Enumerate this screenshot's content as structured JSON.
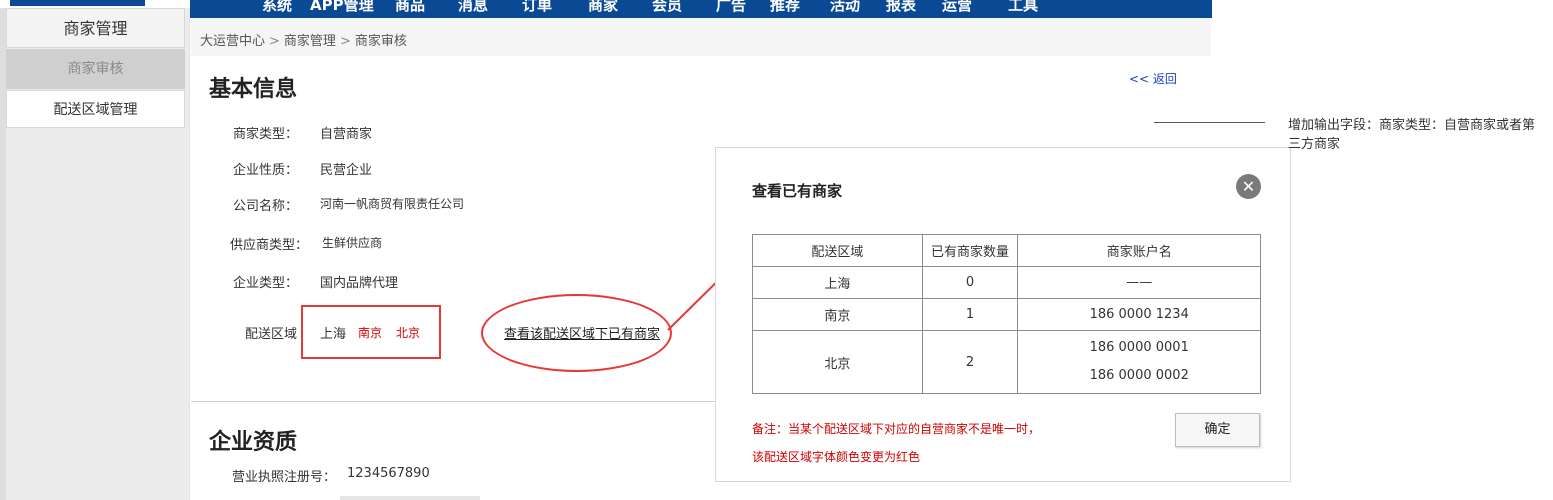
{
  "topnav": {
    "items": [
      "系统",
      "APP管理",
      "商品",
      "消息",
      "订单",
      "商家",
      "会员",
      "广告",
      "推荐",
      "活动",
      "报表",
      "运营",
      "工具"
    ]
  },
  "sidebar": {
    "title": "商家管理",
    "items": [
      {
        "label": "商家审核",
        "active": true
      },
      {
        "label": "配送区域管理",
        "active": false
      }
    ]
  },
  "breadcrumb": {
    "items": [
      "大运营中心",
      "商家管理",
      "商家审核"
    ],
    "separator": ">"
  },
  "basic_info": {
    "title": "基本信息",
    "back_label": "<< 返回",
    "fields": [
      {
        "label": "商家类型：",
        "value": "自营商家"
      },
      {
        "label": "企业性质：",
        "value": "民营企业"
      },
      {
        "label": "公司名称：",
        "value": "河南一帆商贸有限责任公司"
      },
      {
        "label": "供应商类型：",
        "value": "生鲜供应商"
      },
      {
        "label": "企业类型：",
        "value": "国内品牌代理"
      }
    ],
    "delivery": {
      "label": "配送区域",
      "areas": [
        {
          "name": "上海",
          "highlight": false
        },
        {
          "name": "南京",
          "highlight": true
        },
        {
          "name": "北京",
          "highlight": true
        }
      ],
      "view_link": "查看该配送区域下已有商家"
    }
  },
  "qualification": {
    "title": "企业资质",
    "license_label": "营业执照注册号：",
    "license_value": "1234567890"
  },
  "modal": {
    "title": "查看已有商家",
    "close_icon": "close-icon",
    "headers": [
      "配送区域",
      "已有商家数量",
      "商家账户名"
    ],
    "rows": [
      {
        "area": "上海",
        "count": "0",
        "accounts": [
          "——"
        ]
      },
      {
        "area": "南京",
        "count": "1",
        "accounts": [
          "186 0000 1234"
        ]
      },
      {
        "area": "北京",
        "count": "2",
        "accounts": [
          "186 0000 0001",
          "186 0000 0002"
        ]
      }
    ],
    "note_line1": "备注：当某个配送区域下对应的自营商家不是唯一时，",
    "note_line2": "该配送区域字体颜色变更为红色",
    "ok_label": "确定"
  },
  "annotation": {
    "text": "增加输出字段：商家类型：自营商家或者第三方商家"
  },
  "colors": {
    "nav_blue": "#0a4a94",
    "alert_red": "#e53935",
    "text_red": "#d00000",
    "link_blue": "#1a3ec2"
  }
}
